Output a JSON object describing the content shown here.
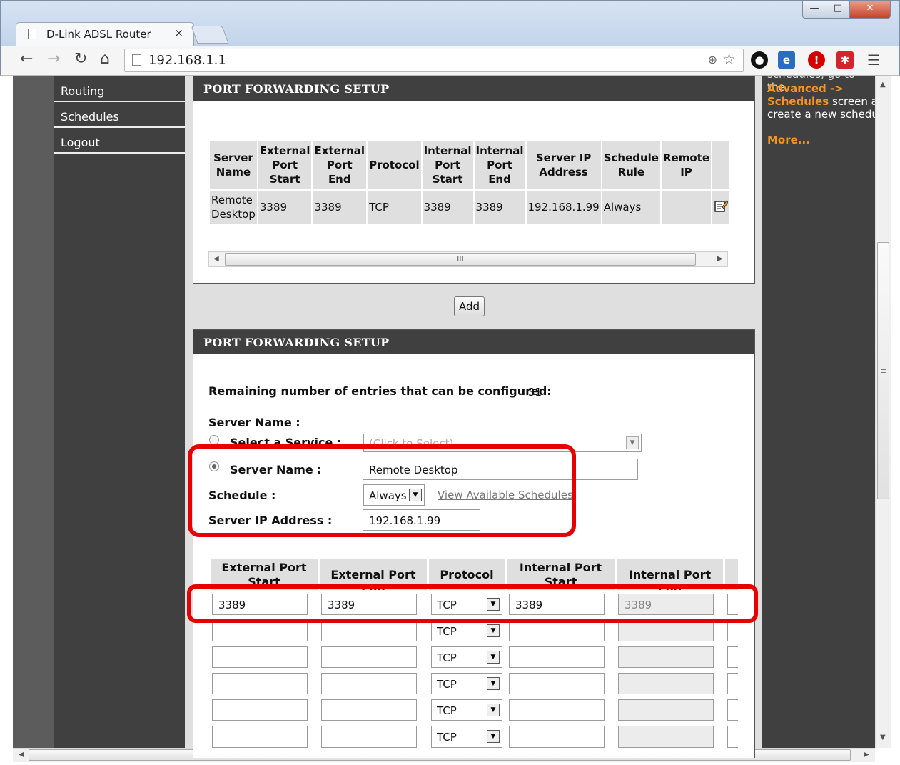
{
  "browser": {
    "tab_title": "D-Link ADSL Router",
    "tab_close": "×",
    "url": "192.168.1.1",
    "window_controls": [
      "minimize-icon",
      "maximize-icon",
      "close-icon"
    ],
    "toolbar_icons": [
      "back-icon",
      "forward-icon",
      "reload-icon",
      "home-icon",
      "zoom-icon",
      "star-icon",
      "menu-icon"
    ],
    "extension_colors": [
      "#111111",
      "#2a6cc0",
      "#d40000",
      "#d3242b"
    ]
  },
  "nav": {
    "items": [
      "Routing",
      "Schedules",
      "Logout"
    ]
  },
  "right_panel": {
    "cut_text": "schedules, go to the",
    "link": "Advanced -> Schedules",
    "text_after": "screen and create a new schedule.",
    "more": "More..."
  },
  "list_section": {
    "header": "PORT FORWARDING SETUP",
    "columns": [
      "Server Name",
      "External Port Start",
      "External Port End",
      "Protocol",
      "Internal Port Start",
      "Internal Port End",
      "Server IP Address",
      "Schedule Rule",
      "Remote IP"
    ],
    "rows": [
      [
        "Remote Desktop",
        "3389",
        "3389",
        "TCP",
        "3389",
        "3389",
        "192.168.1.99",
        "Always",
        ""
      ]
    ],
    "edit_icon": "edit-icon",
    "scroll_label": "III"
  },
  "add_button": "Add",
  "edit_section": {
    "header": "PORT FORWARDING SETUP",
    "remaining_label": "Remaining number of entries that can be configured:",
    "remaining_value": "31",
    "server_name_heading": "Server Name :",
    "select_service_label": "Select a Service :",
    "select_service_placeholder": "(Click to Select)",
    "server_name_label": "Server Name :",
    "server_name_value": "Remote Desktop",
    "schedule_label": "Schedule :",
    "schedule_value": "Always",
    "view_schedules_link": "View Available Schedules",
    "server_ip_label": "Server IP Address :",
    "server_ip_value": "192.168.1.99",
    "port_columns": [
      "External Port Start",
      "External Port End",
      "Protocol",
      "Internal Port Start",
      "Internal Port End"
    ],
    "port_rows": [
      {
        "ext_start": "3389",
        "ext_end": "3389",
        "protocol": "TCP",
        "int_start": "3389",
        "int_end": "3389"
      },
      {
        "ext_start": "",
        "ext_end": "",
        "protocol": "TCP",
        "int_start": "",
        "int_end": ""
      },
      {
        "ext_start": "",
        "ext_end": "",
        "protocol": "TCP",
        "int_start": "",
        "int_end": ""
      },
      {
        "ext_start": "",
        "ext_end": "",
        "protocol": "TCP",
        "int_start": "",
        "int_end": ""
      },
      {
        "ext_start": "",
        "ext_end": "",
        "protocol": "TCP",
        "int_start": "",
        "int_end": ""
      },
      {
        "ext_start": "",
        "ext_end": "",
        "protocol": "TCP",
        "int_start": "",
        "int_end": ""
      }
    ]
  },
  "highlight_color": "#e60000",
  "page_scroll_label": "III"
}
